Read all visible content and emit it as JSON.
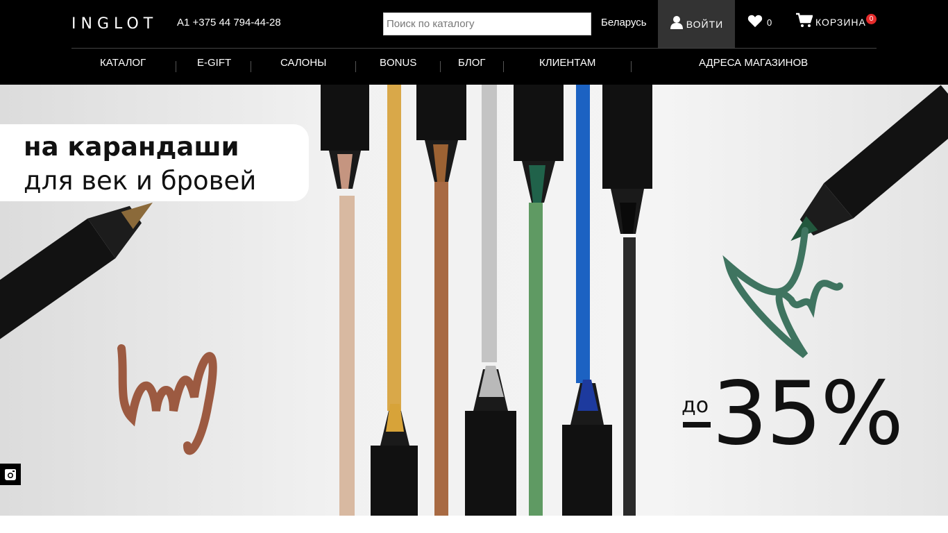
{
  "header": {
    "logo": "INGLOT",
    "phone": "A1 +375 44 794-44-28",
    "search_placeholder": "Поиск по каталогу",
    "country": "Беларусь",
    "login_label": "ВОЙТИ",
    "wishlist_count": "0",
    "cart_label": "КОРЗИНА",
    "cart_count": "0"
  },
  "nav": {
    "items": [
      {
        "label": "КАТАЛОГ"
      },
      {
        "label": "E-GIFT"
      },
      {
        "label": "САЛОНЫ"
      },
      {
        "label": "BONUS"
      },
      {
        "label": "БЛОГ"
      },
      {
        "label": "КЛИЕНТАМ"
      },
      {
        "label": "АДРЕСА МАГАЗИНОВ"
      }
    ]
  },
  "banner": {
    "line1": "на карандаши",
    "line2": "для век и бровей",
    "discount_prefix": "до",
    "discount_value": "35%"
  },
  "colors": {
    "header_bg": "#000000",
    "login_bg": "#333333",
    "badge": "#e52b2b",
    "hero_bg": "#e7e7e7"
  }
}
